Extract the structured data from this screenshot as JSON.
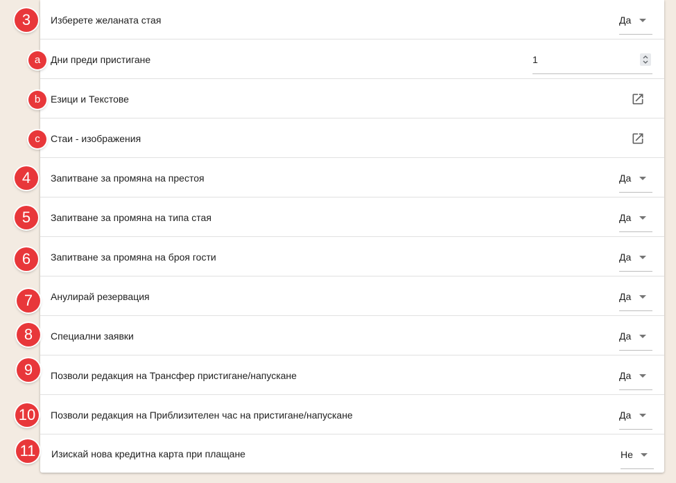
{
  "rows": [
    {
      "marker": "3",
      "label": "Изберете желаната стая",
      "control": "select",
      "value": "Да"
    },
    {
      "marker": "a",
      "label": "Дни преди пристигане",
      "control": "number",
      "value": "1"
    },
    {
      "marker": "b",
      "label": "Езици и Текстове",
      "control": "link",
      "icon": "open-in-new-icon"
    },
    {
      "marker": "c",
      "label": "Стаи - изображения",
      "control": "link",
      "icon": "open-in-new-icon"
    },
    {
      "marker": "4",
      "label": "Запитване за промяна на престоя",
      "control": "select",
      "value": "Да"
    },
    {
      "marker": "5",
      "label": "Запитване за промяна на типа стая",
      "control": "select",
      "value": "Да"
    },
    {
      "marker": "6",
      "label": "Запитване за промяна на броя гости",
      "control": "select",
      "value": "Да"
    },
    {
      "marker": "7",
      "label": "Анулирай резервация",
      "control": "select",
      "value": "Да"
    },
    {
      "marker": "8",
      "label": "Специални заявки",
      "control": "select",
      "value": "Да"
    },
    {
      "marker": "9",
      "label": "Позволи редакция на Трансфер пристигане/напускане",
      "control": "select",
      "value": "Да"
    },
    {
      "marker": "10",
      "label": "Позволи редакция на Приблизителен час на пристигане/напускане",
      "control": "select",
      "value": "Да"
    },
    {
      "marker": "11",
      "label": "Изискай нова кредитна карта при плащане",
      "control": "select",
      "value": "Не"
    }
  ],
  "colors": {
    "badge": "#e8373a",
    "background": "#f3ebe2",
    "panel": "#ffffff",
    "divider": "#e0e0e0"
  }
}
